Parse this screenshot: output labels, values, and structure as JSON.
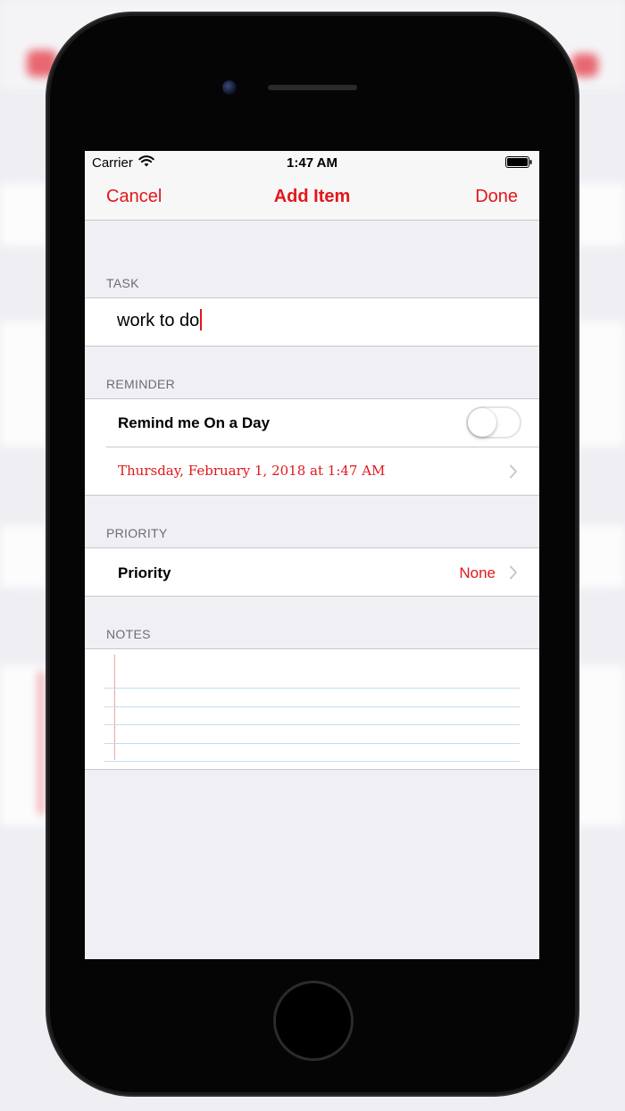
{
  "status_bar": {
    "carrier": "Carrier",
    "time": "1:47 AM"
  },
  "nav": {
    "cancel_label": "Cancel",
    "title": "Add Item",
    "done_label": "Done"
  },
  "task": {
    "header": "TASK",
    "value": "work to do"
  },
  "reminder": {
    "header": "REMINDER",
    "toggle_label": "Remind me On a Day",
    "toggle_on": false,
    "date_text": "Thursday, February 1, 2018 at 1:47 AM"
  },
  "priority": {
    "header": "PRIORITY",
    "label": "Priority",
    "value": "None"
  },
  "notes": {
    "header": "NOTES"
  },
  "colors": {
    "accent": "#e3161b",
    "grouped_background": "#efeff4",
    "separator": "#c8c7cc"
  },
  "icons": [
    "wifi-icon",
    "battery-icon",
    "chevron-right-icon"
  ]
}
